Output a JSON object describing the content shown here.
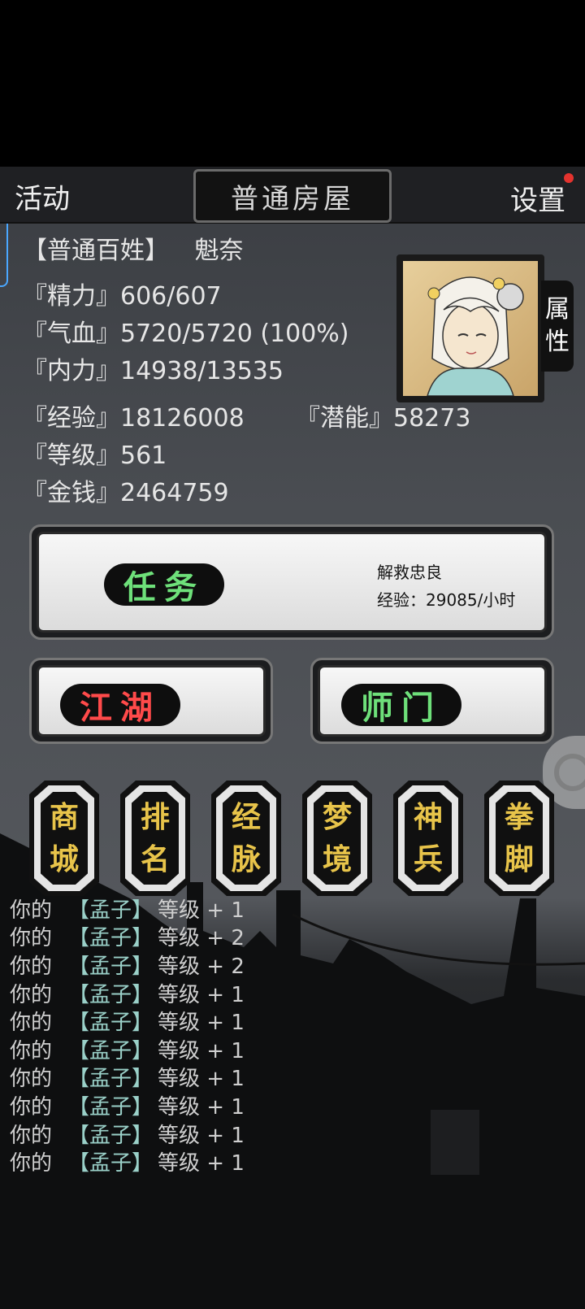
{
  "header": {
    "activity_label": "活动",
    "room_title": "普通房屋",
    "settings_label": "设置"
  },
  "character": {
    "title": "【普通百姓】",
    "name": "魁奈",
    "attr_tab": [
      "属",
      "性"
    ]
  },
  "stats": {
    "energy": {
      "label": "『精力』",
      "value": "606/607"
    },
    "health": {
      "label": "『气血』",
      "value": "5720/5720 (100%)"
    },
    "inner": {
      "label": "『内力』",
      "value": "14938/13535"
    },
    "exp": {
      "label": "『经验』",
      "value": "18126008"
    },
    "potential": {
      "label": "『潜能』",
      "value": "58273"
    },
    "level": {
      "label": "『等级』",
      "value": "561"
    },
    "money": {
      "label": "『金钱』",
      "value": "2464759"
    }
  },
  "task": {
    "label": "任务",
    "name": "解救忠良",
    "rate": "经验：29085/小时"
  },
  "buttons": {
    "jianghu": "江湖",
    "shimen": "师门"
  },
  "menu": [
    [
      "商",
      "城"
    ],
    [
      "排",
      "名"
    ],
    [
      "经",
      "脉"
    ],
    [
      "梦",
      "境"
    ],
    [
      "神",
      "兵"
    ],
    [
      "拳",
      "脚"
    ]
  ],
  "log": [
    {
      "you": "你的",
      "skill": "【孟子】",
      "level": "等级 + 1"
    },
    {
      "you": "你的",
      "skill": "【孟子】",
      "level": "等级 + 2"
    },
    {
      "you": "你的",
      "skill": "【孟子】",
      "level": "等级 + 2"
    },
    {
      "you": "你的",
      "skill": "【孟子】",
      "level": "等级 + 1"
    },
    {
      "you": "你的",
      "skill": "【孟子】",
      "level": "等级 + 1"
    },
    {
      "you": "你的",
      "skill": "【孟子】",
      "level": "等级 + 1"
    },
    {
      "you": "你的",
      "skill": "【孟子】",
      "level": "等级 + 1"
    },
    {
      "you": "你的",
      "skill": "【孟子】",
      "level": "等级 + 1"
    },
    {
      "you": "你的",
      "skill": "【孟子】",
      "level": "等级 + 1"
    },
    {
      "you": "你的",
      "skill": "【孟子】",
      "level": "等级 + 1"
    }
  ]
}
